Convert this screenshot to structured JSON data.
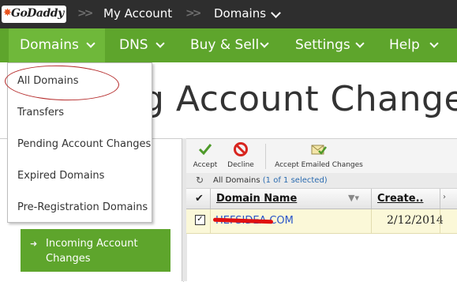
{
  "topbar": {
    "logo_text": "GoDaddy",
    "crumbs": [
      "My Account",
      "Domains"
    ]
  },
  "nav": {
    "items": [
      "Domains",
      "DNS",
      "Buy & Sell",
      "Settings",
      "Help"
    ]
  },
  "page": {
    "title_fragment": "g Account Change"
  },
  "dropdown": {
    "items": [
      "All Domains",
      "Transfers",
      "Pending Account Changes",
      "Expired Domains",
      "Pre-Registration Domains"
    ]
  },
  "sidebar": {
    "active_item": "Incoming Account Changes"
  },
  "toolbar": {
    "accept": "Accept",
    "decline": "Decline",
    "accept_emailed": "Accept Emailed Changes"
  },
  "status": {
    "label": "All Domains",
    "count": "(1 of 1 selected)"
  },
  "grid": {
    "columns": [
      "Domain Name",
      "Create.."
    ],
    "rows": [
      {
        "domain": "HEFSIDEA.COM",
        "created": "2/12/2014",
        "checked": true
      }
    ]
  },
  "colors": {
    "topbar": "#2e2e2e",
    "nav": "#5ea52c",
    "accent_red": "#e01010",
    "link": "#2a55c9"
  },
  "icons": [
    "checkmark-icon",
    "prohibit-icon",
    "envelope-check-icon",
    "refresh-icon",
    "filter-icon"
  ]
}
